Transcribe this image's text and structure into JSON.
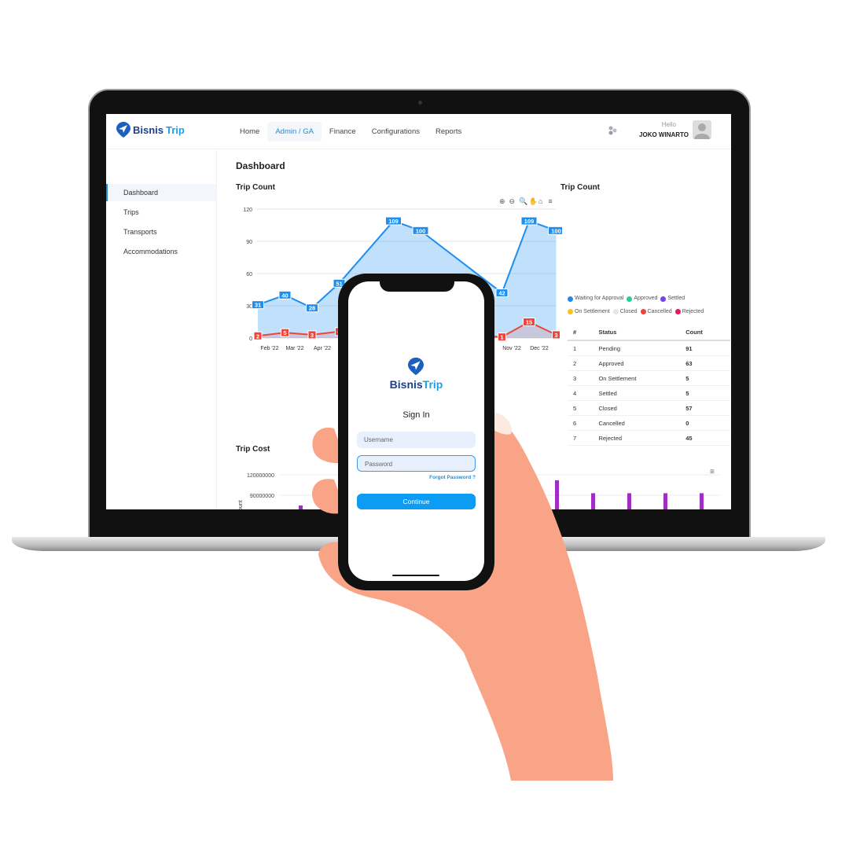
{
  "app": {
    "brand_part1": "Bisnis",
    "brand_part2": "Trip"
  },
  "nav": {
    "items": [
      {
        "label": "Home"
      },
      {
        "label": "Admin / GA",
        "active": true
      },
      {
        "label": "Finance"
      },
      {
        "label": "Configurations"
      },
      {
        "label": "Reports"
      }
    ],
    "greeting": "Hello",
    "user": "JOKO WINARTO"
  },
  "sidebar": {
    "items": [
      {
        "label": "Dashboard",
        "active": true
      },
      {
        "label": "Trips"
      },
      {
        "label": "Transports"
      },
      {
        "label": "Accommodations"
      }
    ]
  },
  "page": {
    "title": "Dashboard"
  },
  "colors": {
    "accent": "#1a8fe3",
    "series_blue": "#1e8ff0",
    "series_red": "#f0443a",
    "bar_purple": "#a32cc4",
    "hand": "#f9a487"
  },
  "chart_data": [
    {
      "type": "area",
      "title": "Trip Count",
      "ylim": [
        0,
        120
      ],
      "yticks": [
        0,
        30,
        60,
        90,
        120
      ],
      "grid": true,
      "xtick_labels": [
        "Feb '22",
        "Mar '22",
        "Apr '22",
        "Nov '22",
        "Dec '22"
      ],
      "series": [
        {
          "values": [
            31,
            40,
            28,
            51,
            null,
            109,
            100,
            null,
            null,
            42,
            109,
            100
          ]
        },
        {
          "values": [
            2,
            5,
            3,
            6,
            null,
            null,
            null,
            null,
            null,
            1,
            15,
            3
          ]
        }
      ],
      "toolbar_icons": [
        "zoom-in-icon",
        "zoom-out-icon",
        "magnifier-icon",
        "pan-hand-icon",
        "home-icon",
        "menu-icon"
      ]
    },
    {
      "type": "bar",
      "title": "Trip Cost",
      "ylabel": "Count",
      "yticks": [
        90000000,
        120000000
      ],
      "grid": true,
      "values": [
        75000000,
        112000000,
        93000000,
        93000000,
        93000000,
        93000000
      ]
    }
  ],
  "status_chart": {
    "title": "Trip Count",
    "legend": [
      {
        "label": "Waiting for Approval",
        "color": "#1e88f0"
      },
      {
        "label": "Approved",
        "color": "#1fd38a"
      },
      {
        "label": "Settled",
        "color": "#7a3ff0"
      },
      {
        "label": "On Settlement",
        "color": "#f8c21a"
      },
      {
        "label": "Closed",
        "color": "#e3e6ee"
      },
      {
        "label": "Cancelled",
        "color": "#f0443a"
      },
      {
        "label": "Rejected",
        "color": "#e8185a"
      }
    ]
  },
  "status_table": {
    "headers": [
      "#",
      "Status",
      "Count"
    ],
    "rows": [
      [
        "1",
        "Pending",
        "91"
      ],
      [
        "2",
        "Approved",
        "63"
      ],
      [
        "3",
        "On Settlement",
        "5"
      ],
      [
        "4",
        "Settled",
        "5"
      ],
      [
        "5",
        "Closed",
        "57"
      ],
      [
        "6",
        "Cancelled",
        "0"
      ],
      [
        "7",
        "Rejected",
        "45"
      ]
    ]
  },
  "phone": {
    "title": "Sign In",
    "username_placeholder": "Username",
    "password_placeholder": "Password",
    "forgot": "Forgot Password ?",
    "continue": "Continue"
  }
}
